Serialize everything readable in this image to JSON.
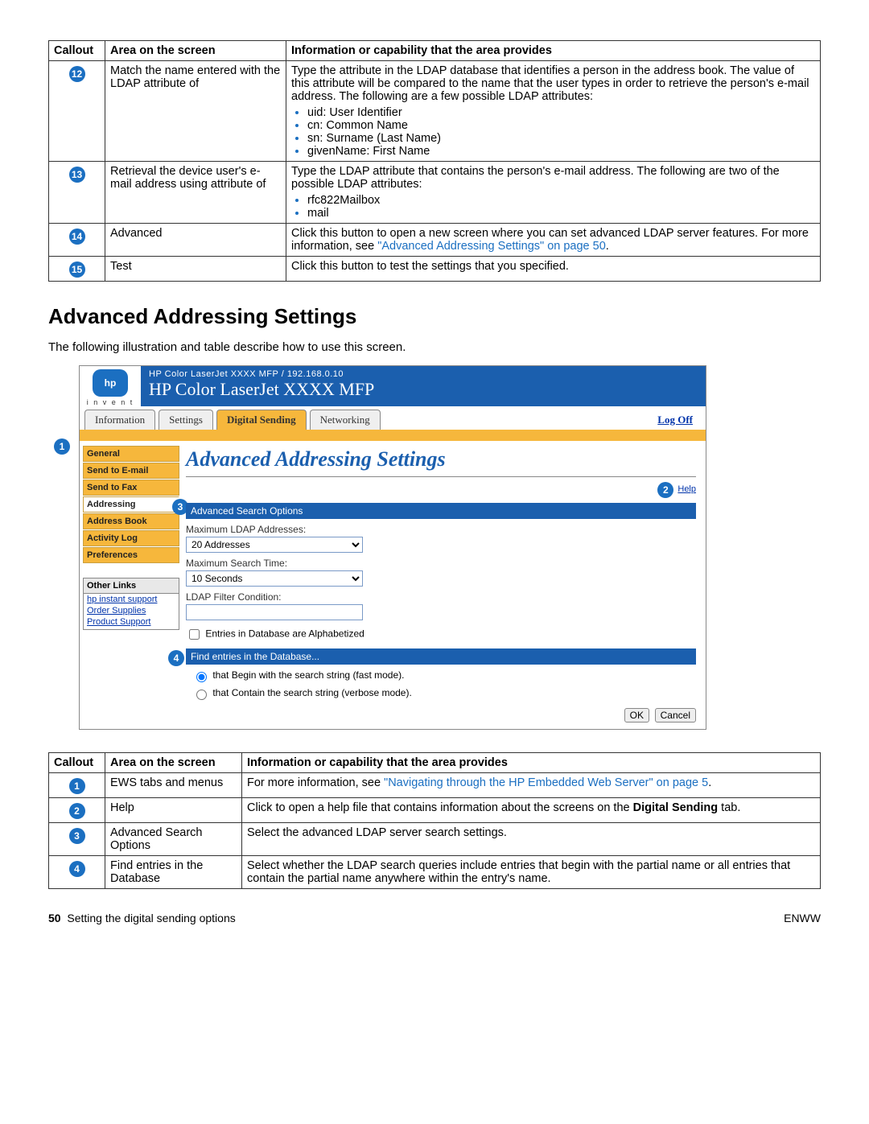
{
  "top_table": {
    "headers": [
      "Callout",
      "Area on the screen",
      "Information or capability that the area provides"
    ],
    "rows": [
      {
        "num": "12",
        "area": "Match the name entered with the LDAP attribute of",
        "info": "Type the attribute in the LDAP database that identifies a person in the address book. The value of this attribute will be compared to the name that the user types in order to retrieve the person's e-mail address. The following are a few possible LDAP attributes:",
        "bullets": [
          "uid: User Identifier",
          "cn: Common Name",
          "sn: Surname (Last Name)",
          "givenName: First Name"
        ]
      },
      {
        "num": "13",
        "area": "Retrieval the device user's e-mail address using attribute of",
        "info": "Type the LDAP attribute that contains the person's e-mail address. The following are two of the possible LDAP attributes:",
        "bullets": [
          "rfc822Mailbox",
          "mail"
        ]
      },
      {
        "num": "14",
        "area": "Advanced",
        "info_prefix": "Click this button to open a new screen where you can set advanced LDAP server features. For more information, see ",
        "info_link": "\"Advanced Addressing Settings\" on page 50",
        "info_suffix": "."
      },
      {
        "num": "15",
        "area": "Test",
        "info": "Click this button to test the settings that you specified."
      }
    ]
  },
  "section_heading": "Advanced Addressing Settings",
  "intro_text": "The following illustration and table describe how to use this screen.",
  "ews": {
    "logo_text": "hp",
    "invent": "i n v e n t",
    "breadcrumb": "HP Color LaserJet XXXX MFP / 192.168.0.10",
    "title": "HP Color LaserJet XXXX MFP",
    "tabs": [
      "Information",
      "Settings",
      "Digital Sending",
      "Networking"
    ],
    "active_tab": "Digital Sending",
    "logoff": "Log Off",
    "nav": [
      "General",
      "Send to E-mail",
      "Send to Fax",
      "Addressing",
      "Address Book",
      "Activity Log",
      "Preferences"
    ],
    "nav_active": "Addressing",
    "other_header": "Other Links",
    "other_links": [
      "hp instant support",
      "Order Supplies",
      "Product Support"
    ],
    "pane_title": "Advanced Addressing Settings",
    "help_label": "Help",
    "sec1": "Advanced Search Options",
    "f1_label": "Maximum LDAP Addresses:",
    "f1_value": "20 Addresses",
    "f2_label": "Maximum Search Time:",
    "f2_value": "10 Seconds",
    "f3_label": "LDAP Filter Condition:",
    "chk_label": "Entries in Database are Alphabetized",
    "sec2": "Find entries in the Database...",
    "r1": "that Begin with the search string (fast mode).",
    "r2": "that Contain the search string (verbose mode).",
    "ok": "OK",
    "cancel": "Cancel",
    "callouts": {
      "c1": "1",
      "c2": "2",
      "c3": "3",
      "c4": "4"
    }
  },
  "bottom_table": {
    "headers": [
      "Callout",
      "Area on the screen",
      "Information or capability that the area provides"
    ],
    "rows": [
      {
        "num": "1",
        "area": "EWS tabs and menus",
        "info_prefix": "For more information, see ",
        "info_link": "\"Navigating through the HP Embedded Web Server\" on page 5",
        "info_suffix": "."
      },
      {
        "num": "2",
        "area": "Help",
        "info_html": "Click to open a help file that contains information about the screens on the <b>Digital Sending</b> tab."
      },
      {
        "num": "3",
        "area": "Advanced Search Options",
        "info": "Select the advanced LDAP server search settings."
      },
      {
        "num": "4",
        "area": "Find entries in the Database",
        "info": "Select whether the LDAP search queries include entries that begin with the partial name or all entries that contain the partial name anywhere within the entry's name."
      }
    ]
  },
  "footer": {
    "page_num": "50",
    "left_text": "Setting the digital sending options",
    "right_text": "ENWW"
  }
}
